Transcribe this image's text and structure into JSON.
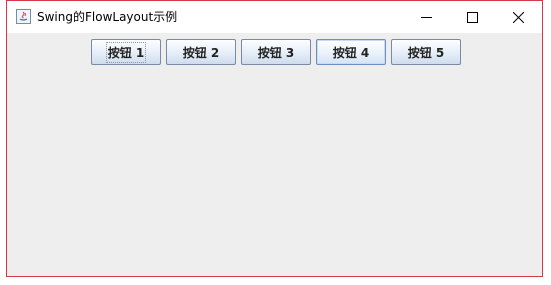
{
  "window": {
    "title": "Swing的FlowLayout示例"
  },
  "buttons": [
    {
      "label": "按钮 1"
    },
    {
      "label": "按钮 2"
    },
    {
      "label": "按钮 3"
    },
    {
      "label": "按钮 4"
    },
    {
      "label": "按钮 5"
    }
  ],
  "colors": {
    "window_border": "#d5384a",
    "content_background": "#eeeeee",
    "button_border": "#7a8aa6"
  }
}
